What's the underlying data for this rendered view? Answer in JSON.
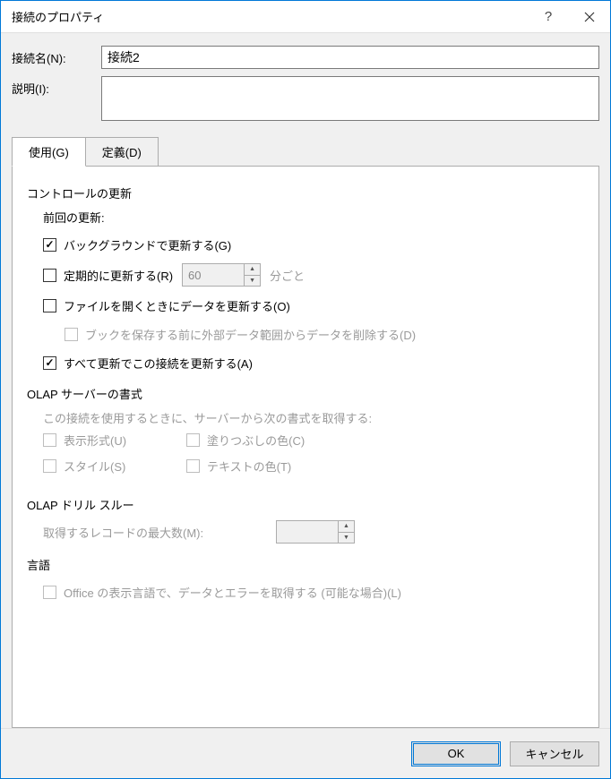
{
  "title": "接続のプロパティ",
  "help_symbol": "?",
  "labels": {
    "connection_name": "接続名(N):",
    "description": "説明(I):"
  },
  "fields": {
    "connection_name": "接続2",
    "description": ""
  },
  "tabs": {
    "usage": "使用(G)",
    "definition": "定義(D)"
  },
  "sections": {
    "refresh_control": "コントロールの更新",
    "last_refresh": "前回の更新:",
    "olap_format": "OLAP サーバーの書式",
    "olap_format_desc": "この接続を使用するときに、サーバーから次の書式を取得する:",
    "olap_drill": "OLAP ドリル スルー",
    "language": "言語"
  },
  "checkboxes": {
    "background_refresh": "バックグラウンドで更新する(G)",
    "periodic_refresh": "定期的に更新する(R)",
    "periodic_unit": "分ごと",
    "refresh_on_open": "ファイルを開くときにデータを更新する(O)",
    "remove_data_on_save": "ブックを保存する前に外部データ範囲からデータを削除する(D)",
    "refresh_all_this_conn": "すべて更新でこの接続を更新する(A)",
    "number_format": "表示形式(U)",
    "fill_color": "塗りつぶしの色(C)",
    "style": "スタイル(S)",
    "text_color": "テキストの色(T)",
    "office_language": "Office の表示言語で、データとエラーを取得する (可能な場合)(L)"
  },
  "spinners": {
    "periodic_minutes": "60",
    "max_records": ""
  },
  "drill": {
    "max_records_label": "取得するレコードの最大数(M):"
  },
  "buttons": {
    "ok": "OK",
    "cancel": "キャンセル"
  }
}
